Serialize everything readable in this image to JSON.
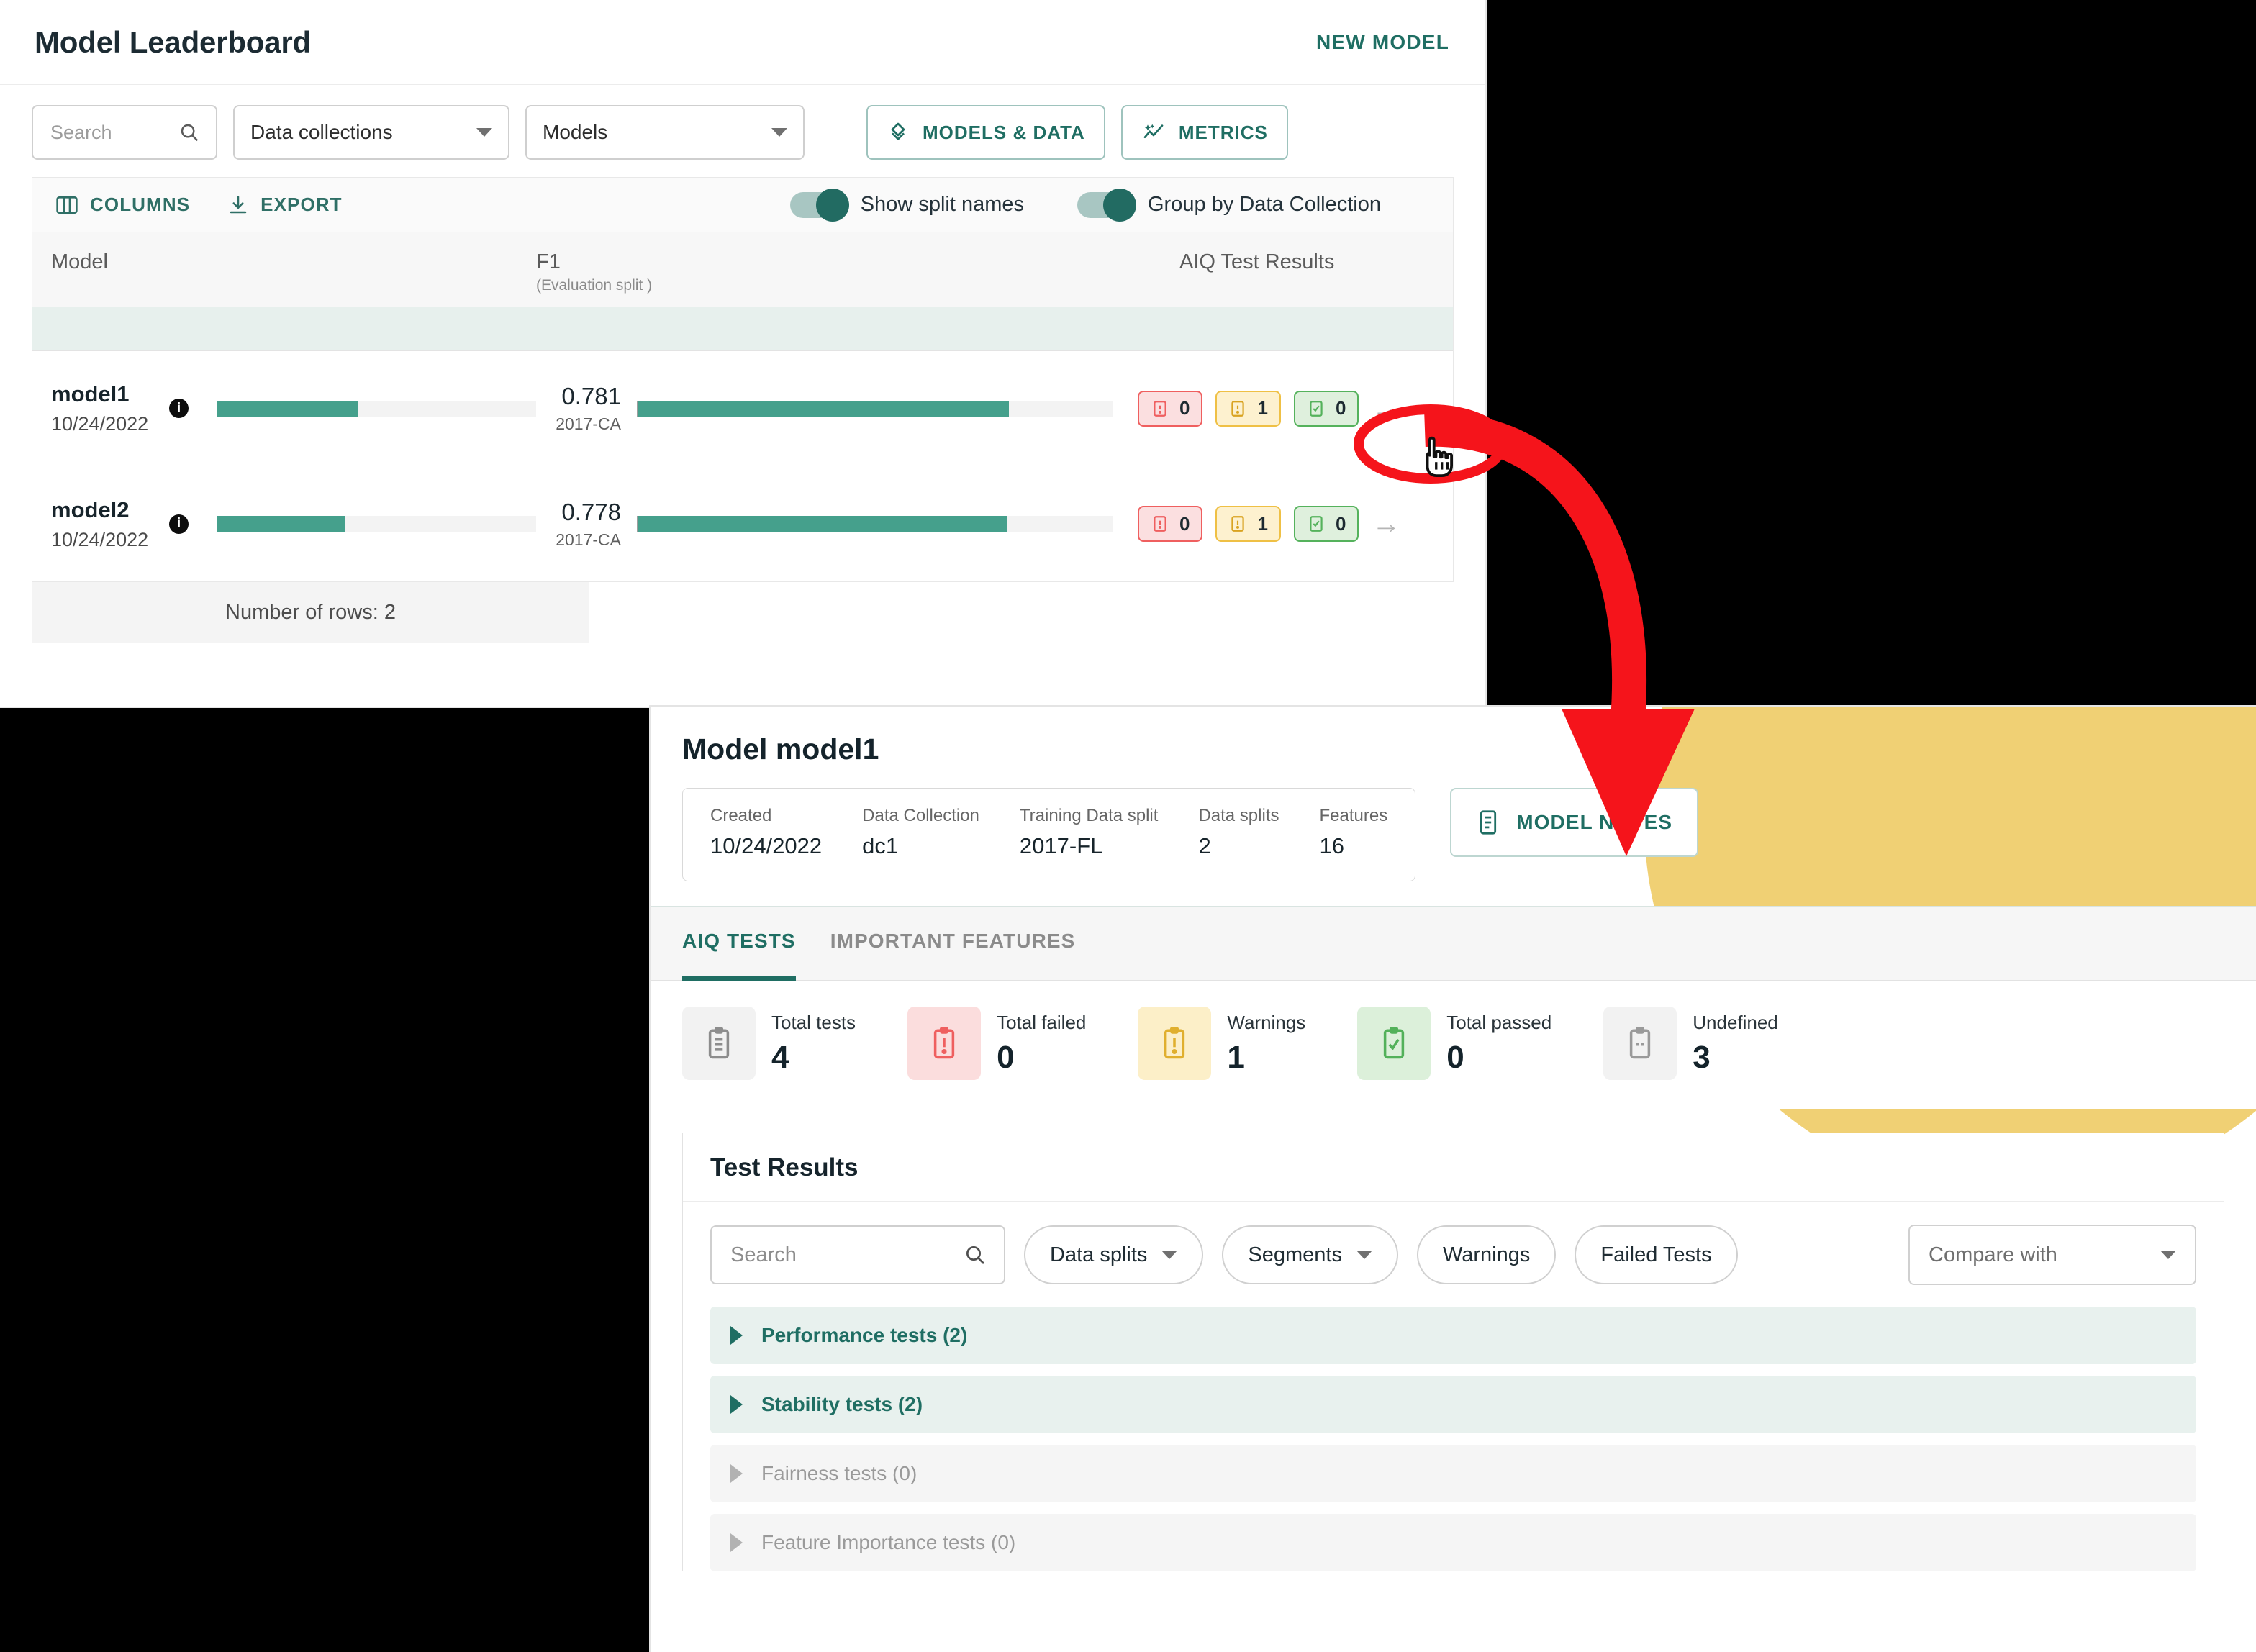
{
  "leaderboard": {
    "title": "Model Leaderboard",
    "new_model_label": "NEW MODEL",
    "search": {
      "placeholder": "Search",
      "value": ""
    },
    "data_collections_label": "Data collections",
    "models_label": "Models",
    "models_data_label": "MODELS & DATA",
    "metrics_label": "METRICS",
    "columns_label": "COLUMNS",
    "export_label": "EXPORT",
    "toggle_split_names_label": "Show split names",
    "toggle_group_by_label": "Group by Data Collection",
    "columns": {
      "model": "Model",
      "f1": "F1",
      "f1_sub": "(Evaluation split )",
      "aiq": "AIQ Test Results"
    },
    "rows": [
      {
        "name": "model1",
        "date": "10/24/2022",
        "mini_pct": 44,
        "f1_value": "0.781",
        "f1_split": "2017-CA",
        "f1_pct": 78.1,
        "failed": "0",
        "warnings": "1",
        "passed": "0",
        "arrow": "→"
      },
      {
        "name": "model2",
        "date": "10/24/2022",
        "mini_pct": 40,
        "f1_value": "0.778",
        "f1_split": "2017-CA",
        "f1_pct": 77.8,
        "failed": "0",
        "warnings": "1",
        "passed": "0",
        "arrow": "→"
      }
    ],
    "footer": "Number of rows: 2"
  },
  "detail": {
    "title": "Model model1",
    "meta": [
      {
        "k": "Created",
        "v": "10/24/2022"
      },
      {
        "k": "Data Collection",
        "v": "dc1"
      },
      {
        "k": "Training Data split",
        "v": "2017-FL"
      },
      {
        "k": "Data splits",
        "v": "2"
      },
      {
        "k": "Features",
        "v": "16"
      }
    ],
    "model_notes_label": "MODEL NOTES",
    "tabs": [
      {
        "label": "AIQ TESTS",
        "active": true
      },
      {
        "label": "IMPORTANT FEATURES",
        "active": false
      }
    ],
    "stats": [
      {
        "label": "Total tests",
        "value": "4",
        "tone": "grey"
      },
      {
        "label": "Total failed",
        "value": "0",
        "tone": "red"
      },
      {
        "label": "Warnings",
        "value": "1",
        "tone": "yellow"
      },
      {
        "label": "Total passed",
        "value": "0",
        "tone": "green"
      },
      {
        "label": "Undefined",
        "value": "3",
        "tone": "grey"
      }
    ],
    "results": {
      "title": "Test Results",
      "search": {
        "placeholder": "Search",
        "value": ""
      },
      "data_splits_label": "Data splits",
      "segments_label": "Segments",
      "warnings_label": "Warnings",
      "failed_tests_label": "Failed Tests",
      "compare_with_label": "Compare with",
      "groups": [
        {
          "label": "Performance tests (2)",
          "enabled": true
        },
        {
          "label": "Stability tests (2)",
          "enabled": true
        },
        {
          "label": "Fairness tests (0)",
          "enabled": false
        },
        {
          "label": "Feature Importance tests (0)",
          "enabled": false
        }
      ]
    }
  },
  "colors": {
    "accent_teal": "#1f6e63",
    "bar_green": "#45a08c",
    "fail_red": "#ef5f5f",
    "warn_yellow": "#efc045",
    "pass_green": "#55b25c",
    "annotation_red": "#f5141b",
    "blob_yellow": "#f0d074"
  }
}
